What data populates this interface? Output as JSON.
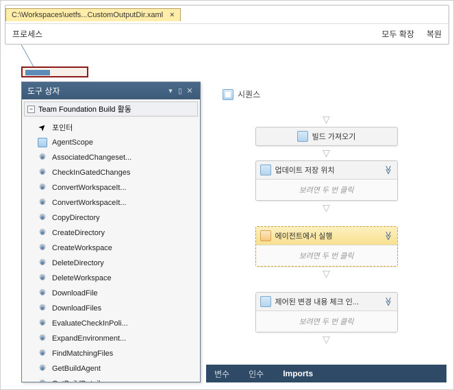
{
  "tab": {
    "title": "C:\\Workspaces\\uetfs...CustomOutputDir.xaml"
  },
  "subbar": {
    "left": "프로세스",
    "expand": "모두 확장",
    "restore": "복원"
  },
  "toolbox": {
    "title": "도구 상자",
    "group": "Team Foundation Build 활동",
    "items": [
      {
        "label": "포인터",
        "icon": "pointer"
      },
      {
        "label": "AgentScope",
        "icon": "scope"
      },
      {
        "label": "AssociatedChangeset...",
        "icon": "gear"
      },
      {
        "label": "CheckInGatedChanges",
        "icon": "gear"
      },
      {
        "label": "ConvertWorkspaceIt...",
        "icon": "gear"
      },
      {
        "label": "ConvertWorkspaceIt...",
        "icon": "gear"
      },
      {
        "label": "CopyDirectory",
        "icon": "gear"
      },
      {
        "label": "CreateDirectory",
        "icon": "gear"
      },
      {
        "label": "CreateWorkspace",
        "icon": "gear"
      },
      {
        "label": "DeleteDirectory",
        "icon": "gear"
      },
      {
        "label": "DeleteWorkspace",
        "icon": "gear"
      },
      {
        "label": "DownloadFile",
        "icon": "gear"
      },
      {
        "label": "DownloadFiles",
        "icon": "gear"
      },
      {
        "label": "EvaluateCheckInPoli...",
        "icon": "gear"
      },
      {
        "label": "ExpandEnvironment...",
        "icon": "gear"
      },
      {
        "label": "FindMatchingFiles",
        "icon": "gear"
      },
      {
        "label": "GetBuildAgent",
        "icon": "gear"
      },
      {
        "label": "GetBuildDetail",
        "icon": "gear"
      }
    ]
  },
  "designer": {
    "sequence_label": "시퀀스",
    "double_click_hint": "보려면 두 번 클릭",
    "activities": [
      {
        "label": "빌드 가져오기",
        "type": "simple",
        "icon": "blue"
      },
      {
        "label": "업데이트 저장 위치",
        "type": "expandable",
        "icon": "blue"
      },
      {
        "label": "에이전트에서 실행",
        "type": "expandable",
        "icon": "orange",
        "highlight": true
      },
      {
        "label": "제어된 변경 내용 체크 인...",
        "type": "expandable",
        "icon": "blue"
      }
    ]
  },
  "bottom_tabs": {
    "variables": "변수",
    "arguments": "인수",
    "imports": "Imports"
  }
}
